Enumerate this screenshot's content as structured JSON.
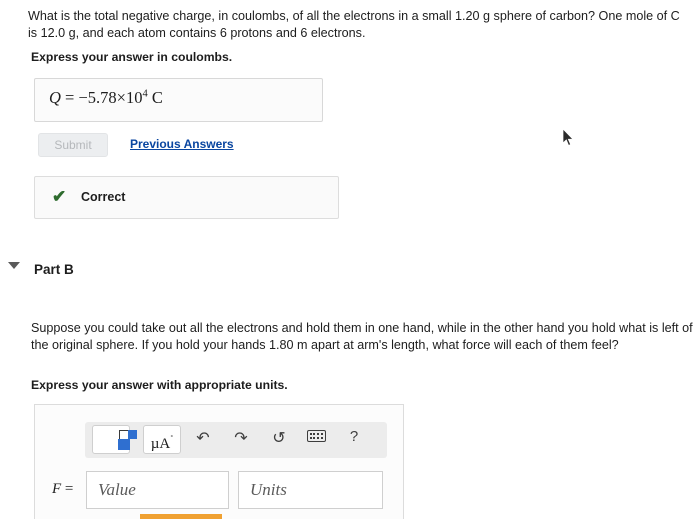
{
  "part_a": {
    "question_line1": "What is the total negative charge, in coulombs, of all the electrons in a small 1.20 g sphere of carbon? One",
    "question_line2": "mole of C is 12.0 g, and each atom contains 6 protons and 6 electrons.",
    "instruction": "Express your answer in coulombs.",
    "answer": {
      "variable": "Q",
      "equals": "=",
      "mantissa": "−5.78×10",
      "exponent": "4",
      "unit": "C"
    },
    "submit_label": "Submit",
    "previous_answers_label": "Previous Answers",
    "feedback": {
      "icon": "check-icon",
      "label": "Correct"
    }
  },
  "part_b": {
    "header": "Part B",
    "caret": "caret-down-icon",
    "question_line1": "Suppose you could take out all the electrons and hold them in one hand, while in the other hand you hold what",
    "question_line2": "is left of the original sphere. If you hold your hands 1.80 m apart at arm's length, what force will each of them",
    "question_line3": "feel?",
    "instruction": "Express your answer with appropriate units.",
    "toolbar": {
      "template_button": "template-icon",
      "units_button": "µA",
      "units_button_ring": "˚",
      "undo": "↶",
      "redo": "↷",
      "reset": "↺",
      "keyboard": "keyboard-icon",
      "help": "?"
    },
    "answer": {
      "variable": "F",
      "equals": "=",
      "value_placeholder": "Value",
      "units_placeholder": "Units"
    }
  },
  "colors": {
    "link": "#0a46a0",
    "accent_blue": "#2f6fd0",
    "correct_green": "#2e6b2e",
    "orange_bar": "#f0a132"
  }
}
